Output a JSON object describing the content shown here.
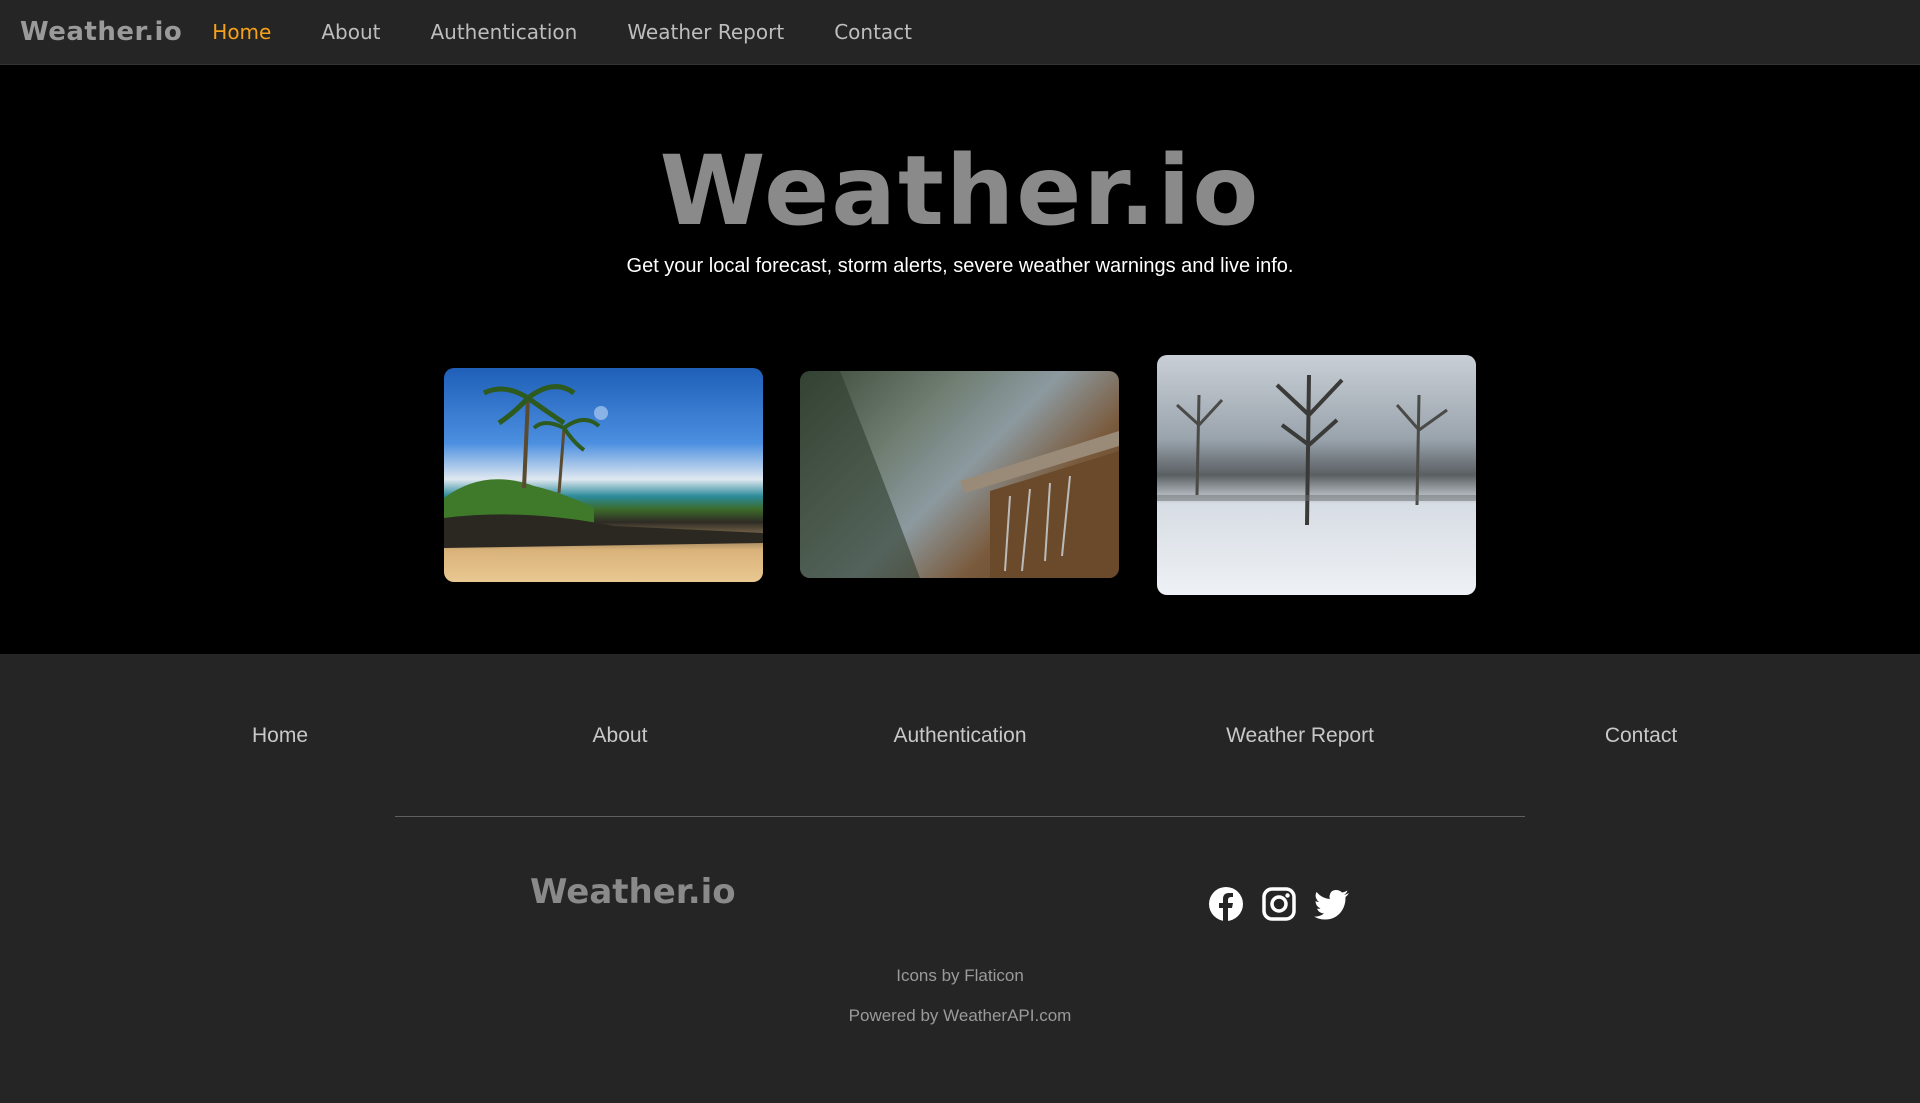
{
  "nav": {
    "brand": "Weather.io",
    "links": [
      "Home",
      "About",
      "Authentication",
      "Weather Report",
      "Contact"
    ],
    "active": "Home"
  },
  "hero": {
    "title": "Weather.io",
    "tagline": "Get your local forecast, storm alerts, severe weather warnings and live info."
  },
  "cards": [
    {
      "icon": "beach-photo"
    },
    {
      "icon": "rain-photo"
    },
    {
      "icon": "snow-photo"
    }
  ],
  "footer": {
    "links": [
      "Home",
      "About",
      "Authentication",
      "Weather Report",
      "Contact"
    ],
    "logo": "Weather.io",
    "social": [
      "facebook-icon",
      "instagram-icon",
      "twitter-icon"
    ],
    "credit_icons": "Icons by Flaticon",
    "credit_api": "Powered by WeatherAPI.com"
  },
  "colors": {
    "accent": "#f5a11a",
    "nav_bg": "#252525",
    "hero_bg": "#000000"
  }
}
